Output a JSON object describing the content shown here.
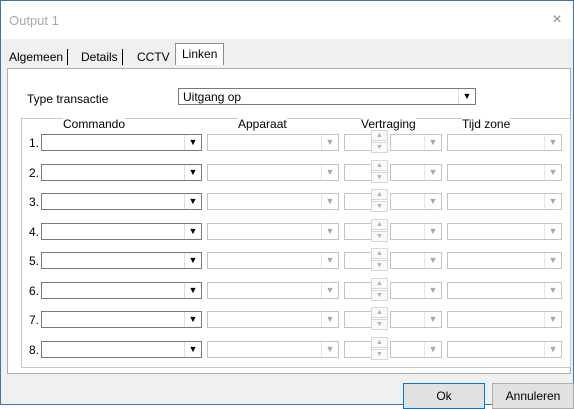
{
  "window": {
    "title": "Output 1",
    "close_symbol": "×"
  },
  "tabs": [
    {
      "label": "Algemeen"
    },
    {
      "label": "Details"
    },
    {
      "label": "CCTV"
    },
    {
      "label": "Linken"
    }
  ],
  "form": {
    "type_label": "Type transactie",
    "type_value": "Uitgang op",
    "dropdown_arrow": "▼",
    "spin_up": "▲",
    "spin_down": "▼"
  },
  "columns": {
    "commando": "Commando",
    "apparaat": "Apparaat",
    "vertraging": "Vertraging",
    "tijd_zone": "Tijd zone"
  },
  "rows": [
    "1.",
    "2.",
    "3.",
    "4.",
    "5.",
    "6.",
    "7.",
    "8."
  ],
  "buttons": {
    "ok": "Ok",
    "cancel": "Annuleren"
  }
}
